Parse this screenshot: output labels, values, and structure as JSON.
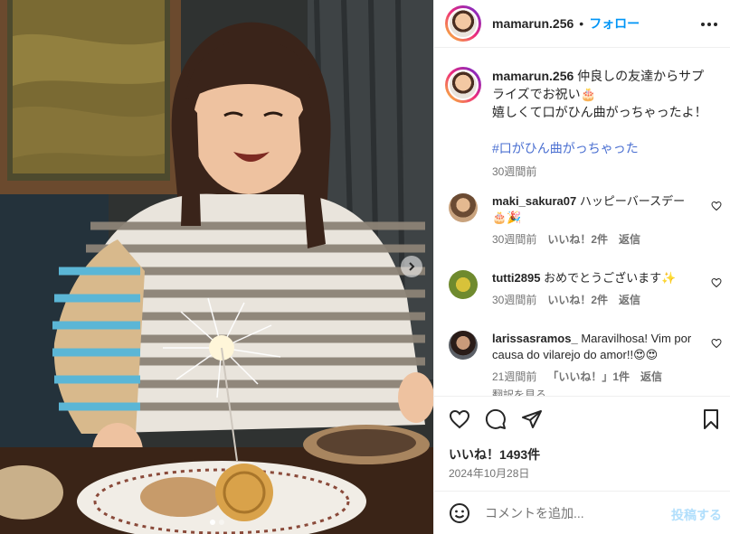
{
  "post": {
    "photo_alt": "",
    "carousel": {
      "count": 2,
      "active": 1
    }
  },
  "header": {
    "username": "mamarun.256",
    "separator": "•",
    "follow_label": "フォロー"
  },
  "caption": {
    "username": "mamarun.256",
    "line1": "仲良しの友達からサプライズでお祝い🎂",
    "line2": "嬉しくて口がひん曲がっちゃったよ！",
    "hashtag": "#口がひん曲がっちゃった",
    "time": "30週間前"
  },
  "comments": [
    {
      "username": "maki_sakura07",
      "text": "ハッピーバースデー🎂🎉",
      "time": "30週間前",
      "likes": "いいね！2件",
      "reply": "返信"
    },
    {
      "username": "tutti2895",
      "text": "おめでとうございます✨",
      "time": "30週間前",
      "likes": "いいね！2件",
      "reply": "返信"
    },
    {
      "username": "larissasramos_",
      "text": "Maravilhosa! Vim por causa do vilarejo do amor!!😍😍",
      "time": "21週間前",
      "likes": "「いいね！」1件",
      "reply": "返信",
      "translate": "翻訳を見る"
    }
  ],
  "actions": {
    "likes": "いいね！1493件",
    "date": "2024年10月28日"
  },
  "comment_box": {
    "placeholder": "コメントを追加...",
    "post_label": "投稿する"
  },
  "icons": [
    "more-icon",
    "heart-icon",
    "comment-icon",
    "share-icon",
    "bookmark-icon",
    "emoji-icon",
    "chevron-right-icon"
  ],
  "colors": {
    "link": "#0095f6",
    "muted": "#737373",
    "text": "#262626",
    "border": "#efefef"
  }
}
